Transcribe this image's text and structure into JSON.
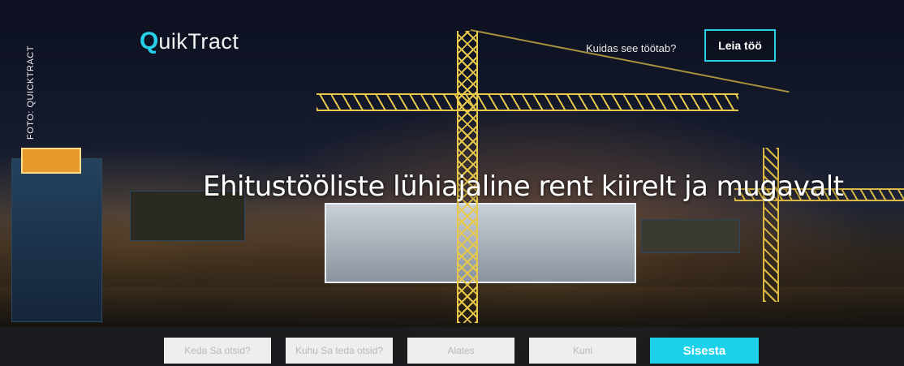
{
  "photo_credit": "FOTO: QUICKTRACT",
  "logo": {
    "q": "Q",
    "rest": "uikTract"
  },
  "nav": {
    "how_it_works": "Kuidas see töötab?",
    "find_job": "Leia töö"
  },
  "hero": {
    "headline": "Ehitustööliste lühiajaline rent kiirelt ja mugavalt"
  },
  "search_form": {
    "who_placeholder": "Keda Sa otsid?",
    "where_placeholder": "Kuhu Sa teda otsid?",
    "from_placeholder": "Alates",
    "until_placeholder": "Kuni",
    "submit_label": "Sisesta"
  },
  "colors": {
    "accent": "#27d0e9",
    "submit_bg": "#1ed1ea",
    "bar_bg": "#181a1e"
  }
}
